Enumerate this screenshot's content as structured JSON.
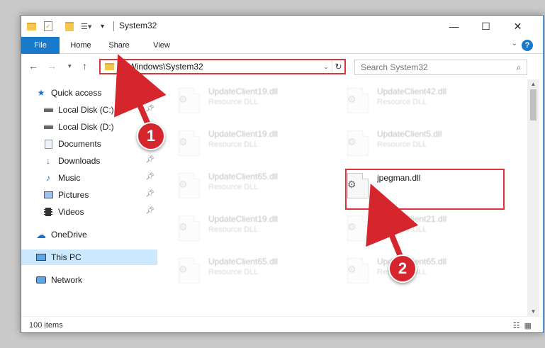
{
  "window": {
    "title": "System32",
    "controls": {
      "minimize": "—",
      "maximize": "☐",
      "close": "✕"
    }
  },
  "ribbon": {
    "tabs": [
      {
        "label": "File"
      },
      {
        "label": "Home"
      },
      {
        "label": "Share"
      },
      {
        "label": "View"
      }
    ],
    "help": "?"
  },
  "address_bar": {
    "path": "C:\\Windows\\System32"
  },
  "search": {
    "placeholder": "Search System32"
  },
  "nav": {
    "items": [
      {
        "label": "Quick access",
        "icon": "star-icon"
      },
      {
        "label": "Local Disk (C:)",
        "icon": "drive-icon"
      },
      {
        "label": "Local Disk (D:)",
        "icon": "drive-icon"
      },
      {
        "label": "Documents",
        "icon": "documents-icon"
      },
      {
        "label": "Downloads",
        "icon": "download-icon"
      },
      {
        "label": "Music",
        "icon": "music-icon"
      },
      {
        "label": "Pictures",
        "icon": "pictures-icon"
      },
      {
        "label": "Videos",
        "icon": "videos-icon"
      },
      {
        "label": "OneDrive",
        "icon": "cloud-icon"
      },
      {
        "label": "This PC",
        "icon": "computer-icon"
      },
      {
        "label": "Network",
        "icon": "network-icon"
      }
    ]
  },
  "files": [
    {
      "name": "UpdateClient19.dll",
      "type": "Resource DLL"
    },
    {
      "name": "UpdateClient42.dll",
      "type": "Resource DLL"
    },
    {
      "name": "UpdateClient19.dll",
      "type": "Resource DLL"
    },
    {
      "name": "UpdateClient5.dll",
      "type": "Resource DLL"
    },
    {
      "name": "UpdateClient65.dll",
      "type": "Resource DLL"
    },
    {
      "name": "jpegman.dll",
      "type": ""
    },
    {
      "name": "UpdateClient19.dll",
      "type": "Resource DLL"
    },
    {
      "name": "UpdateClient21.dll",
      "type": "Resource DLL"
    },
    {
      "name": "UpdateClient65.dll",
      "type": "Resource DLL"
    },
    {
      "name": "UpdateClient65.dll",
      "type": "Resource DLL"
    }
  ],
  "status": {
    "item_count": "100 items"
  },
  "annotations": {
    "badge1": "1",
    "badge2": "2",
    "color": "#d6262d"
  }
}
